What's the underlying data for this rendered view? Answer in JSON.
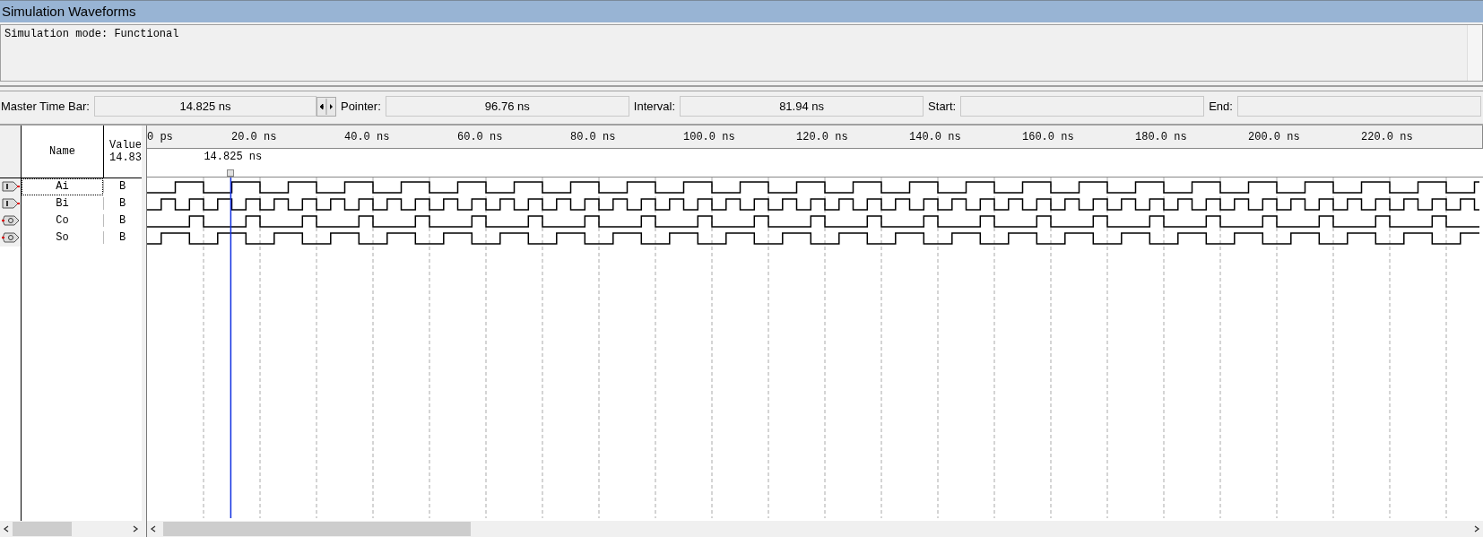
{
  "title": "Simulation Waveforms",
  "messages": [
    "Simulation mode: Functional"
  ],
  "time_bar": [
    {
      "label": "Master Time Bar:",
      "value": "14.825 ns",
      "kind": "master"
    },
    {
      "label": "Pointer:",
      "value": "96.76 ns",
      "kind": "plain"
    },
    {
      "label": "Interval:",
      "value": "81.94 ns",
      "kind": "plain"
    },
    {
      "label": "Start:",
      "kind": "plain"
    },
    {
      "label": "End:",
      "kind": "plain"
    }
  ],
  "columns": {
    "name": "Name",
    "value": "Value",
    "value_time": "14.83"
  },
  "timeline": {
    "ticks": [
      "0 ps",
      "20.0 ns",
      "40.0 ns",
      "60.0 ns",
      "80.0 ns",
      "100.0 ns",
      "120.0 ns",
      "140.0 ns",
      "160.0 ns",
      "180.0 ns",
      "200.0 ns",
      "220.0 ns"
    ],
    "cursor_label": "14.825 ns"
  },
  "signals": [
    {
      "name": "Ai",
      "value": "B",
      "kind": "input",
      "selected": true
    },
    {
      "name": "Bi",
      "value": "B",
      "kind": "input",
      "selected": false
    },
    {
      "name": "Co",
      "value": "B",
      "kind": "output",
      "selected": false
    },
    {
      "name": "So",
      "value": "B",
      "kind": "output",
      "selected": false
    }
  ]
}
